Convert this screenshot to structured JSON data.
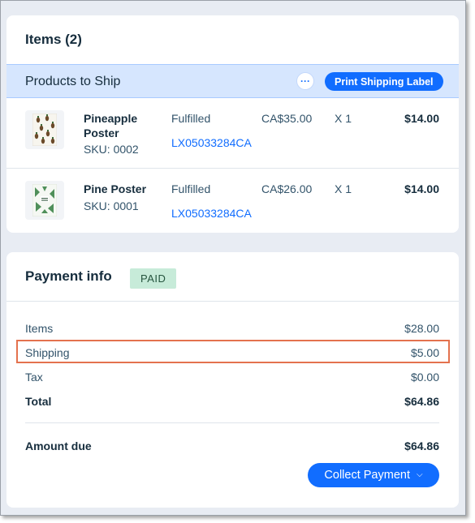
{
  "items_card": {
    "title": "Items (2)"
  },
  "shipping_bar": {
    "title": "Products to Ship",
    "more_icon": "···",
    "print_label": "Print Shipping Label"
  },
  "products": [
    {
      "name": "Pineapple Poster",
      "sku": "SKU: 0002",
      "status": "Fulfilled",
      "tracking": "LX05033284CA",
      "unit_price": "CA$35.00",
      "qty": "X 1",
      "total": "$14.00"
    },
    {
      "name": "Pine Poster",
      "sku": "SKU: 0001",
      "status": "Fulfilled",
      "tracking": "LX05033284CA",
      "unit_price": "CA$26.00",
      "qty": "X 1",
      "total": "$14.00"
    }
  ],
  "payment": {
    "title": "Payment info",
    "badge": "PAID",
    "items_label": "Items",
    "items_value": "$28.00",
    "shipping_label": "Shipping",
    "shipping_value": "$5.00",
    "tax_label": "Tax",
    "tax_value": "$0.00",
    "total_label": "Total",
    "total_value": "$64.86",
    "due_label": "Amount due",
    "due_value": "$64.86",
    "collect_label": "Collect Payment"
  },
  "colors": {
    "accent": "#116dff",
    "ship_bar_bg": "#d6e6fe",
    "paid_badge_bg": "#c7ebd9",
    "highlight_border": "#e4724e"
  }
}
